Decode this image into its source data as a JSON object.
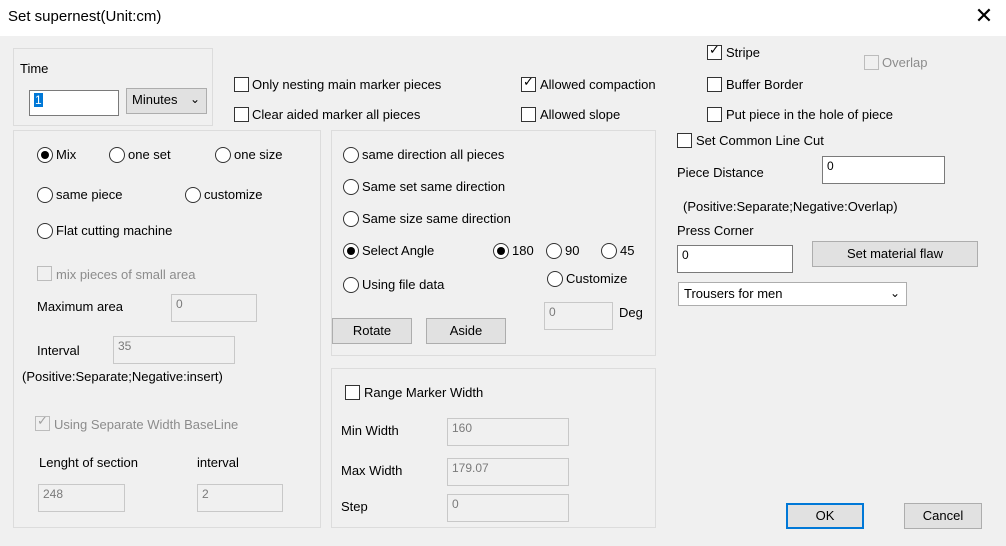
{
  "dialog": {
    "title": "Set supernest(Unit:cm)",
    "close_glyph": "✕"
  },
  "time": {
    "label": "Time",
    "value": "1",
    "unit_selected": "Minutes"
  },
  "top_options": {
    "only_nesting_main": {
      "label": "Only nesting main marker pieces",
      "checked": false
    },
    "clear_aided": {
      "label": "Clear aided marker all pieces",
      "checked": false
    },
    "allowed_compaction": {
      "label": "Allowed compaction",
      "checked": true
    },
    "allowed_slope": {
      "label": "Allowed slope",
      "checked": false
    },
    "stripe": {
      "label": "Stripe",
      "checked": true
    },
    "overlap": {
      "label": "Overlap",
      "checked": false,
      "disabled": true
    },
    "buffer_border": {
      "label": "Buffer Border",
      "checked": false
    },
    "put_piece_in_hole": {
      "label": "Put piece in the hole of piece",
      "checked": false
    }
  },
  "mix_group": {
    "mix": "Mix",
    "one_set": "one set",
    "one_size": "one size",
    "same_piece": "same piece",
    "customize": "customize",
    "flat_cutting": "Flat cutting machine",
    "selected": "Mix",
    "mix_small_area": "mix pieces of small area",
    "max_area_label": "Maximum area",
    "max_area_value": "0",
    "interval_label": "Interval",
    "interval_value": "35",
    "interval_note": "(Positive:Separate;Negative:insert)",
    "sep_width": "Using Separate Width BaseLine",
    "length_section_label": "Lenght of section",
    "length_section_value": "248",
    "interval2_label": "interval",
    "interval2_value": "2"
  },
  "direction_group": {
    "same_dir_all": "same direction all pieces",
    "same_set_dir": "Same set same direction",
    "same_size_dir": "Same size same direction",
    "select_angle": "Select Angle",
    "using_file": "Using file data",
    "selected": "Select Angle",
    "angle_180": "180",
    "angle_90": "90",
    "angle_45": "45",
    "angle_selected": "180",
    "customize": "Customize",
    "deg_value": "0",
    "deg_label": "Deg",
    "rotate_btn": "Rotate",
    "aside_btn": "Aside"
  },
  "range_group": {
    "range_marker": "Range Marker Width",
    "min_label": "Min Width",
    "min_value": "160",
    "max_label": "Max Width",
    "max_value": "179.07",
    "step_label": "Step",
    "step_value": "0"
  },
  "right_panel": {
    "common_line_cut": "Set Common Line Cut",
    "piece_distance_label": "Piece Distance",
    "piece_distance_value": "0",
    "piece_distance_note": "(Positive:Separate;Negative:Overlap)",
    "press_corner_label": "Press  Corner",
    "press_corner_value": "0",
    "material_flaw_btn": "Set material flaw",
    "garment_selected": "Trousers for men"
  },
  "footer": {
    "ok": "OK",
    "cancel": "Cancel"
  }
}
